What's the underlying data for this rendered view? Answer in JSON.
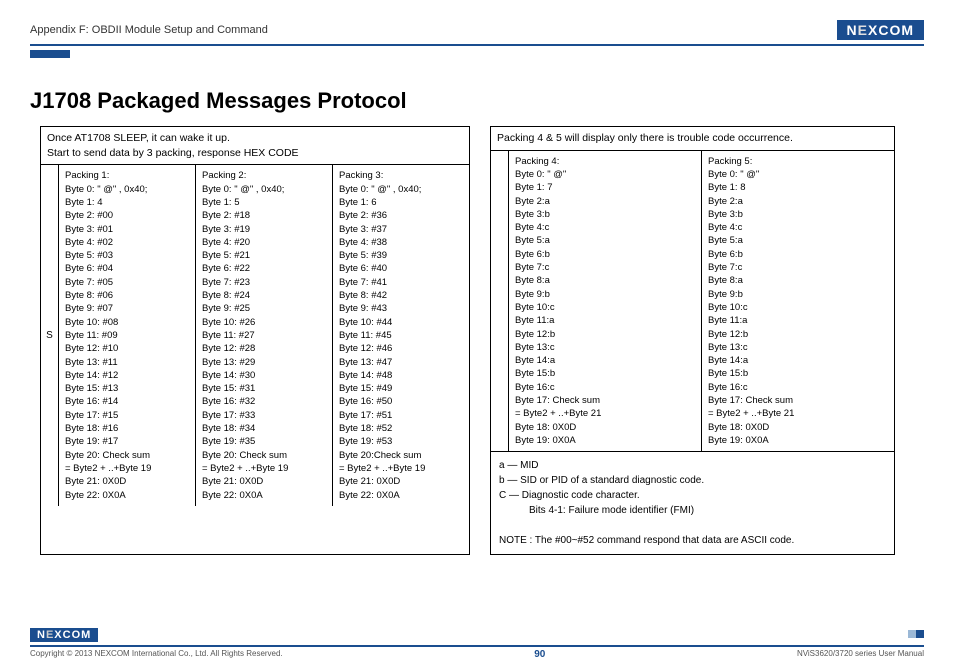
{
  "header": {
    "appendix": "Appendix F: OBDII Module Setup and Command",
    "logo": "NEXCOM"
  },
  "title": "J1708 Packaged Messages Protocol",
  "block1": {
    "intro": "Once AT1708 SLEEP, it can wake it up.\nStart to send data by 3 packing, response HEX CODE",
    "side": "S",
    "cols": [
      {
        "name": "Packing 1:",
        "lines": [
          "Byte 0: \" @\" , 0x40;",
          "Byte 1: 4",
          "Byte 2: #00",
          "Byte 3: #01",
          "Byte 4: #02",
          "Byte 5: #03",
          "Byte 6: #04",
          "Byte 7: #05",
          "Byte 8: #06",
          "Byte 9: #07",
          "Byte 10: #08",
          "Byte 11: #09",
          "Byte 12: #10",
          "Byte 13: #11",
          "Byte 14: #12",
          "Byte 15: #13",
          "Byte 16: #14",
          "Byte 17: #15",
          "Byte 18: #16",
          "Byte 19: #17",
          "Byte 20: Check sum",
          "= Byte2 + ..+Byte 19",
          "Byte 21: 0X0D",
          "Byte 22: 0X0A"
        ]
      },
      {
        "name": "Packing 2:",
        "lines": [
          "Byte 0: \" @\" , 0x40;",
          "Byte 1: 5",
          "Byte 2: #18",
          "Byte 3: #19",
          "Byte 4: #20",
          "Byte 5: #21",
          "Byte 6: #22",
          "Byte 7: #23",
          "Byte 8: #24",
          "Byte 9: #25",
          "Byte 10: #26",
          "Byte 11: #27",
          "Byte 12: #28",
          "Byte 13: #29",
          "Byte 14: #30",
          "Byte 15: #31",
          "Byte 16: #32",
          "Byte 17: #33",
          "Byte 18: #34",
          "Byte 19: #35",
          "Byte 20: Check sum",
          "= Byte2 + ..+Byte 19",
          "Byte 21: 0X0D",
          "Byte 22: 0X0A"
        ]
      },
      {
        "name": "Packing 3:",
        "lines": [
          "Byte 0: \" @\" , 0x40;",
          "Byte 1: 6",
          "Byte 2: #36",
          "Byte 3: #37",
          "Byte 4: #38",
          "Byte 5: #39",
          "Byte 6: #40",
          "Byte 7: #41",
          "Byte 8: #42",
          "Byte 9: #43",
          "Byte 10: #44",
          "Byte 11: #45",
          "Byte 12: #46",
          "Byte 13: #47",
          "Byte 14: #48",
          "Byte 15: #49",
          "Byte 16: #50",
          "Byte 17: #51",
          "Byte 18: #52",
          "Byte 19: #53",
          "Byte 20:Check sum",
          "= Byte2 + ..+Byte 19",
          "Byte 21: 0X0D",
          "Byte 22: 0X0A"
        ]
      }
    ]
  },
  "block2": {
    "intro": "Packing 4 & 5 will display only there is trouble code occurrence.",
    "cols": [
      {
        "name": "Packing 4:",
        "lines": [
          "Byte 0: \" @\"",
          "Byte 1: 7",
          "Byte 2:a",
          "Byte 3:b",
          "Byte 4:c",
          "Byte 5:a",
          "Byte 6:b",
          "Byte 7:c",
          "Byte 8:a",
          "Byte 9:b",
          "Byte 10:c",
          "Byte 11:a",
          "Byte 12:b",
          "Byte 13:c",
          "Byte 14:a",
          "Byte 15:b",
          "Byte 16:c",
          "Byte 17: Check sum",
          "= Byte2 + ..+Byte 21",
          "Byte 18: 0X0D",
          "Byte 19: 0X0A"
        ]
      },
      {
        "name": "Packing 5:",
        "lines": [
          "Byte 0: \" @\"",
          "Byte 1: 8",
          "Byte 2:a",
          "Byte 3:b",
          "Byte 4:c",
          "Byte 5:a",
          "Byte 6:b",
          "Byte 7:c",
          "Byte 8:a",
          "Byte 9:b",
          "Byte 10:c",
          "Byte 11:a",
          "Byte 12:b",
          "Byte 13:c",
          "Byte 14:a",
          "Byte 15:b",
          "Byte 16:c",
          "Byte 17: Check sum",
          "= Byte2 + ..+Byte 21",
          "Byte 18: 0X0D",
          "Byte 19: 0X0A"
        ]
      }
    ],
    "notes": [
      "a — MID",
      "b — SID or PID of a standard diagnostic code.",
      "C — Diagnostic code character.",
      "Bits 4-1: Failure mode identifier (FMI)"
    ],
    "note2": "NOTE : The #00~#52 command respond that data are ASCII code."
  },
  "footer": {
    "copyright": "Copyright © 2013 NEXCOM International Co., Ltd. All Rights Reserved.",
    "page": "90",
    "manual": "NViS3620/3720 series User Manual"
  }
}
